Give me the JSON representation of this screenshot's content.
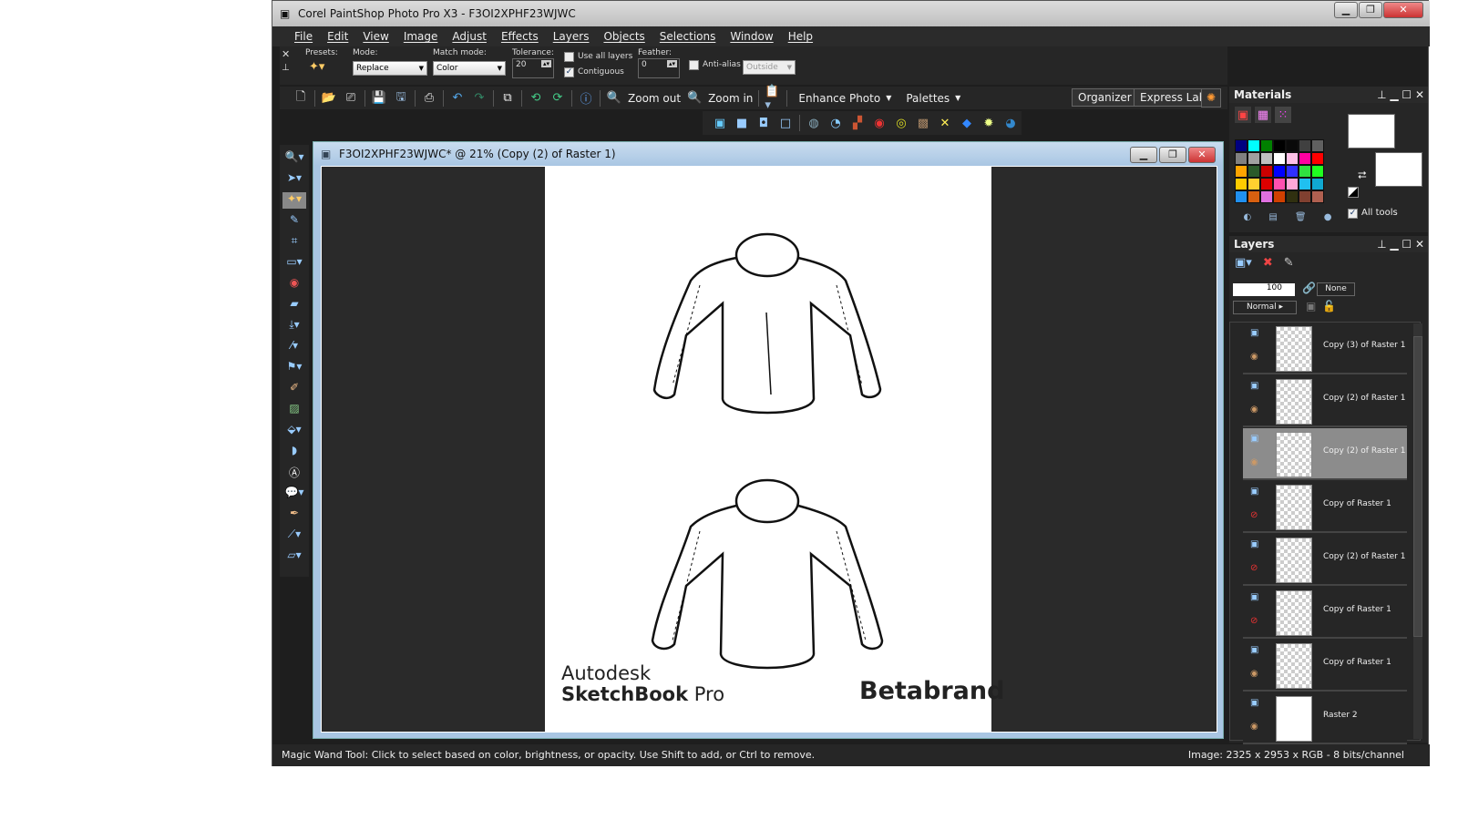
{
  "window": {
    "title": "Corel PaintShop Photo Pro X3 - F3OI2XPHF23WJWC"
  },
  "menu": [
    "File",
    "Edit",
    "View",
    "Image",
    "Adjust",
    "Effects",
    "Layers",
    "Objects",
    "Selections",
    "Window",
    "Help"
  ],
  "options": {
    "presets_label": "Presets:",
    "mode_label": "Mode:",
    "mode_value": "Replace",
    "match_label": "Match mode:",
    "match_value": "Color",
    "tolerance_label": "Tolerance:",
    "tolerance_value": "20",
    "use_all_layers": "Use all layers",
    "use_all_layers_checked": false,
    "contiguous": "Contiguous",
    "contiguous_checked": true,
    "feather_label": "Feather:",
    "feather_value": "0",
    "antialias": "Anti-alias",
    "antialias_checked": false,
    "outside_value": "Outside"
  },
  "toolbar": {
    "zoom_out": "Zoom out",
    "zoom_in": "Zoom in",
    "enhance_photo": "Enhance Photo",
    "palettes": "Palettes",
    "organizer": "Organizer",
    "express_lab": "Express Lab"
  },
  "document": {
    "title": "F3OI2XPHF23WJWC* @  21% (Copy (2) of Raster 1)",
    "logo_left_1": "Autodesk",
    "logo_left_2": "SketchBook",
    "logo_left_3": "Pro",
    "logo_right": "Betabrand"
  },
  "materials": {
    "title": "Materials",
    "all_tools": "All tools",
    "all_tools_checked": true,
    "swatches": [
      "#000080",
      "#00ffff",
      "#008000",
      "#000000",
      "#0a0a0a",
      "#404040",
      "#606060",
      "#808080",
      "#a0a0a0",
      "#c0c0c0",
      "#ffffff",
      "#ffc0e8",
      "#ff00a0",
      "#ff0000",
      "#ffa500",
      "#2a5a2a",
      "#cc0000",
      "#0000ff",
      "#3030ff",
      "#30e040",
      "#20ff20",
      "#ffcc00",
      "#ffd030",
      "#dd0000",
      "#ff50b0",
      "#ffa8d8",
      "#20c0f0",
      "#10a8d0",
      "#2090f0",
      "#d86010",
      "#e070e0",
      "#d04000",
      "#303010",
      "#804030",
      "#b06050"
    ]
  },
  "layers": {
    "title": "Layers",
    "opacity": "100",
    "blend": "Normal",
    "mask": "None",
    "items": [
      {
        "name": "Copy (3) of Raster 1",
        "visible": true,
        "selected": false
      },
      {
        "name": "Copy (2) of Raster 1",
        "visible": true,
        "selected": false
      },
      {
        "name": "Copy (2) of Raster 1",
        "visible": true,
        "selected": true
      },
      {
        "name": "Copy of Raster 1",
        "visible": false,
        "selected": false
      },
      {
        "name": "Copy (2) of Raster 1",
        "visible": false,
        "selected": false
      },
      {
        "name": "Copy of Raster 1",
        "visible": false,
        "selected": false
      },
      {
        "name": "Copy of Raster 1",
        "visible": true,
        "selected": false
      },
      {
        "name": "Raster 2",
        "visible": true,
        "selected": false
      }
    ]
  },
  "status": {
    "left": "Magic Wand Tool: Click to select based on color, brightness, or opacity. Use Shift to add, or Ctrl to remove.",
    "right": "Image:  2325 x 2953 x RGB - 8 bits/channel"
  }
}
